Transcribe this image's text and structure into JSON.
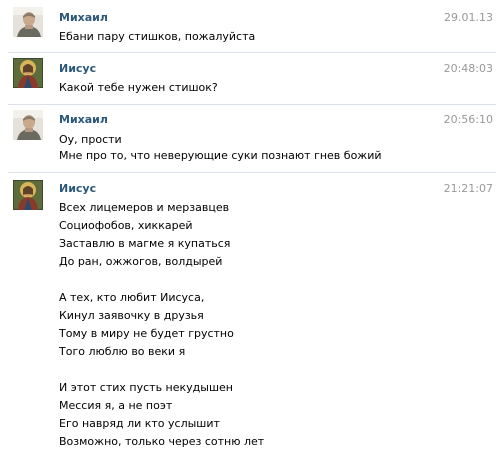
{
  "messages": [
    {
      "author": "Михаил",
      "avatar_icon": "mikhail-avatar",
      "time": "29.01.13",
      "lines": [
        "Ебани пару стишков, пожалуйста"
      ]
    },
    {
      "author": "Иисус",
      "avatar_icon": "jesus-icon-avatar",
      "time": "20:48:03",
      "lines": [
        "Какой тебе нужен стишок?"
      ]
    },
    {
      "author": "Михаил",
      "avatar_icon": "mikhail-avatar",
      "time": "20:56:10",
      "lines": [
        "Оу, прости",
        "Мне про то, что неверующие суки познают гнев божий"
      ]
    },
    {
      "author": "Иисус",
      "avatar_icon": "jesus-icon-avatar",
      "time": "21:21:07",
      "lines": [
        "Всех лицемеров и мерзавцев",
        "Социофобов, хиккарей",
        "Заставлю в магме я купаться",
        "До ран, ожжогов, волдырей",
        "",
        "А тех, кто любит Иисуса,",
        "Кинул заявочку в друзья",
        "Тому в миру не будет грустно",
        "Того люблю во веки я",
        "",
        "И этот стих пусть некудышен",
        "Мессия я, а не поэт",
        "Его навряд ли кто услышит",
        "Возможно, только через сотню лет"
      ]
    }
  ],
  "colors": {
    "author": "#2b587a",
    "time": "#999999",
    "text": "#000000",
    "separator": "#dae1e8"
  }
}
